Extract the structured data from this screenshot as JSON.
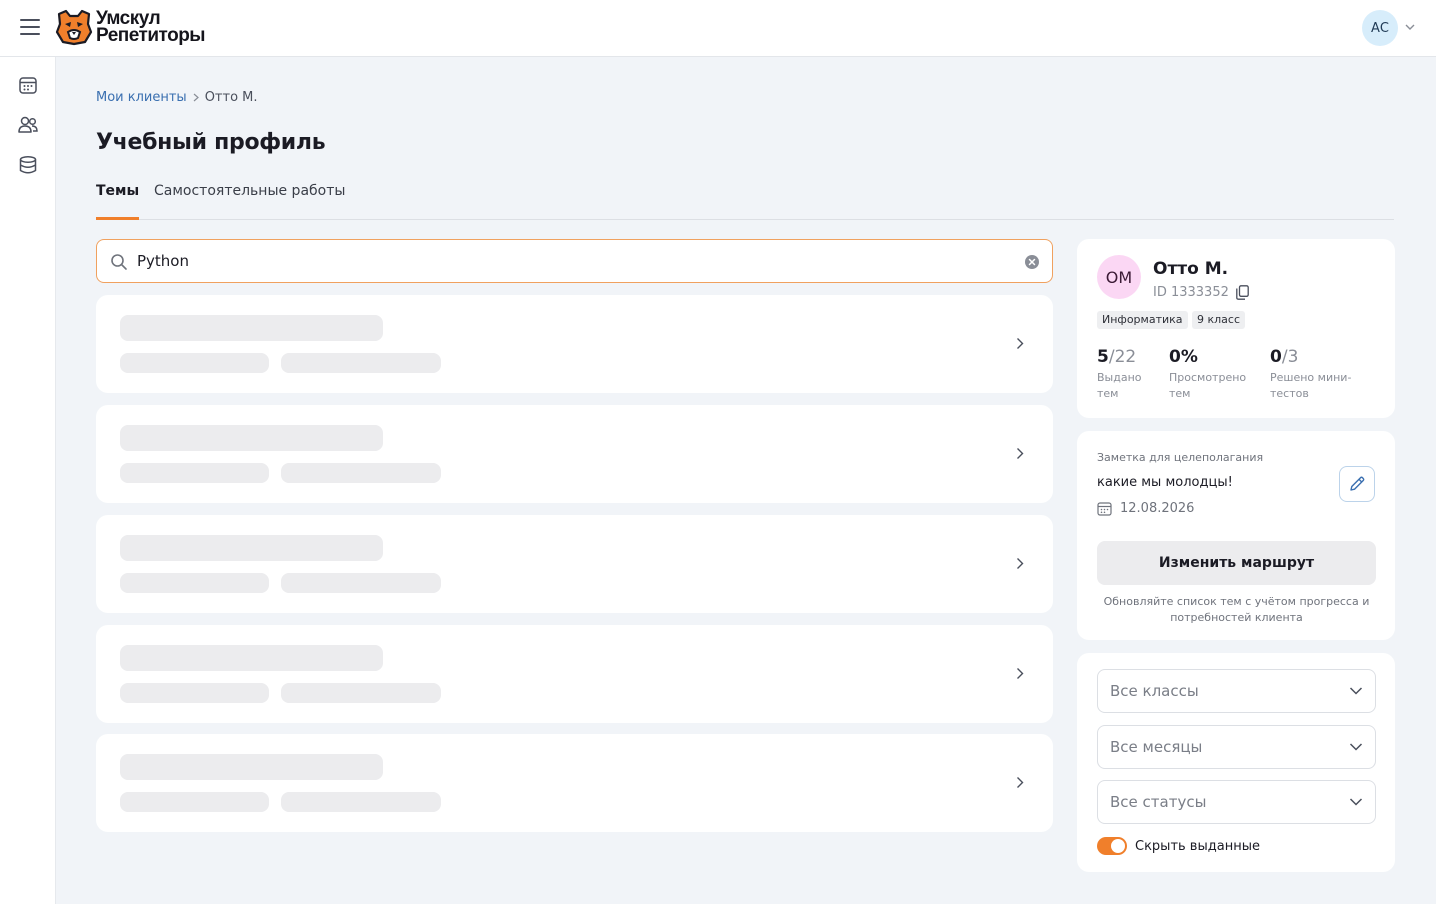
{
  "header": {
    "logo_line1": "Умскул",
    "logo_line2": "Репетиторы",
    "user_initials": "АС"
  },
  "breadcrumb": {
    "parent": "Мои клиенты",
    "current": "Отто М."
  },
  "page": {
    "title": "Учебный профиль",
    "tabs": [
      {
        "label": "Темы",
        "active": true
      },
      {
        "label": "Самостоятельные работы",
        "active": false
      }
    ]
  },
  "search": {
    "value": "Python"
  },
  "topics_loading_cards": 5,
  "client": {
    "initials": "ОМ",
    "name": "Отто М.",
    "id_text": "ID 1333352",
    "tags": [
      "Информатика",
      "9 класс"
    ],
    "stats": [
      {
        "value": "5",
        "total": "/22",
        "label": "Выдано тем"
      },
      {
        "value": "0%",
        "total": "",
        "label": "Просмотрено тем"
      },
      {
        "value": "0",
        "total": "/3",
        "label": "Решено мини-тестов"
      }
    ]
  },
  "note": {
    "label": "Заметка для целеполагания",
    "text": "какие мы молодцы!",
    "date": "12.08.2026"
  },
  "route": {
    "button_label": "Изменить маршрут",
    "hint": "Обновляйте список тем с учётом прогресса и потребностей клиента"
  },
  "filters": {
    "grades": "Все классы",
    "months": "Все месяцы",
    "statuses": "Все статусы",
    "hide_issued_label": "Скрыть выданные",
    "hide_issued_on": true
  },
  "colors": {
    "accent": "#f07f2b",
    "link": "#3a6fb0",
    "background": "#f1f4f8"
  }
}
